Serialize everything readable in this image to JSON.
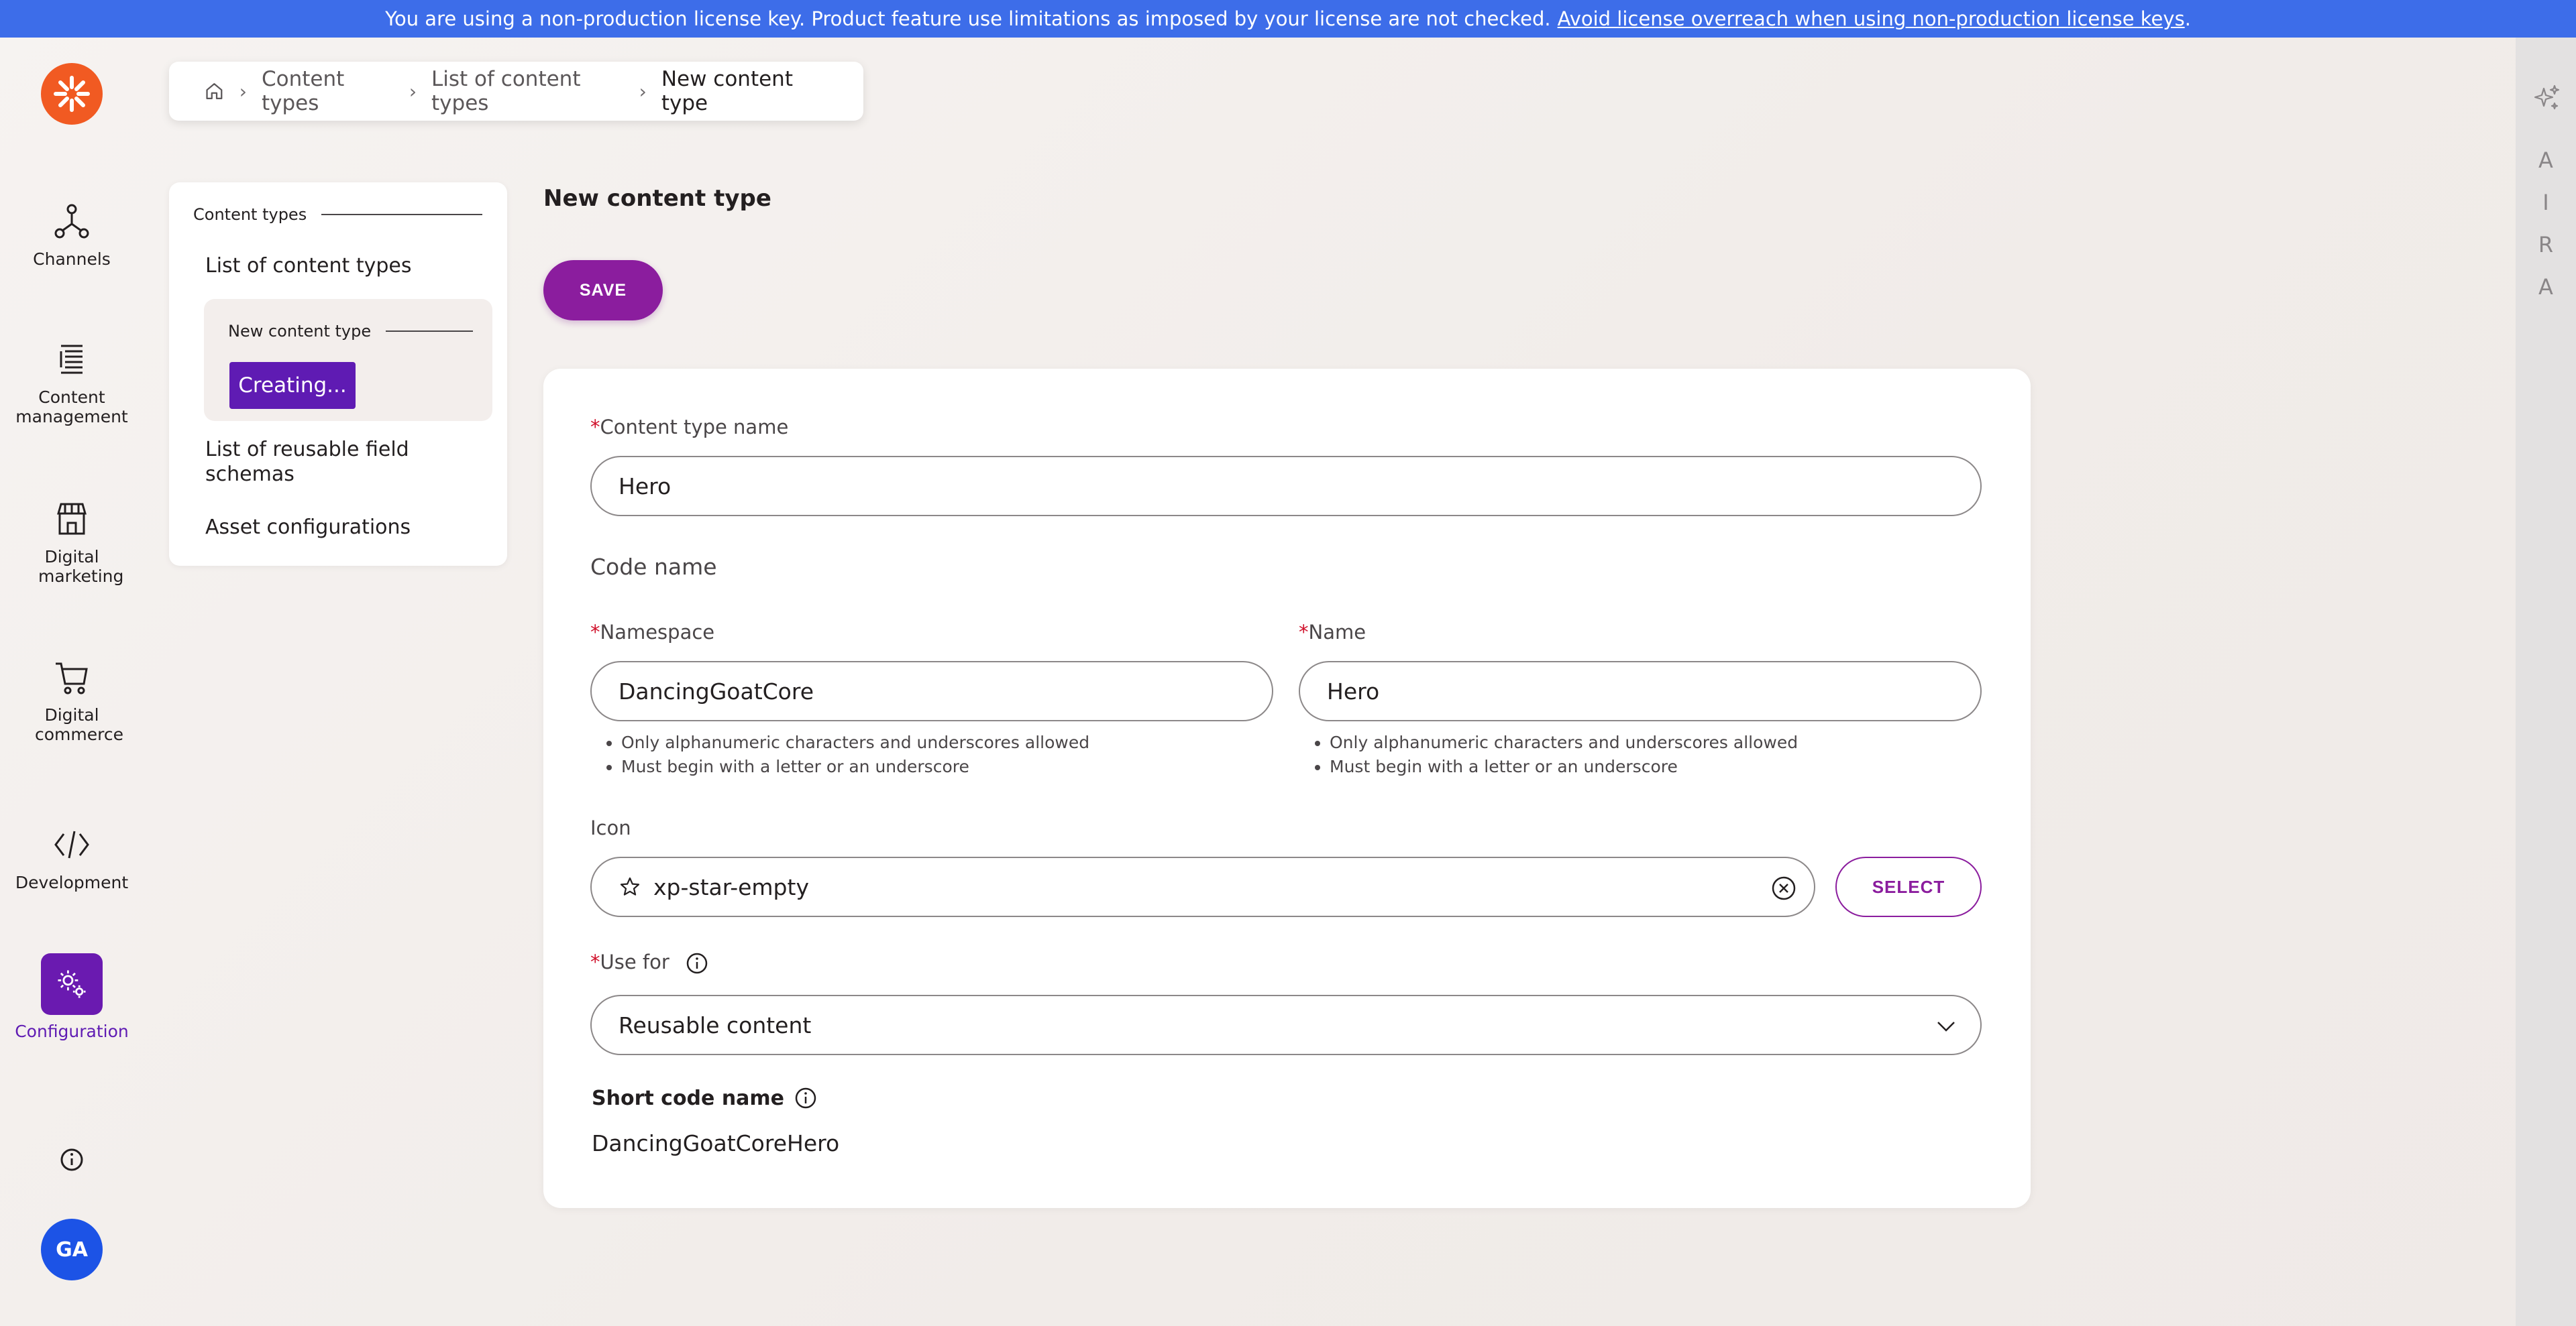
{
  "banner": {
    "message": "You are using a non-production license key. Product feature use limitations as imposed by your license are not checked.",
    "link": "Avoid license overreach when using non-production license keys",
    "suffix": "."
  },
  "nav": {
    "items": [
      {
        "label": "Channels"
      },
      {
        "label": "Content management"
      },
      {
        "label": "Digital marketing"
      },
      {
        "label": "Digital commerce"
      },
      {
        "label": "Development"
      },
      {
        "label": "Configuration"
      }
    ],
    "avatar": "GA"
  },
  "breadcrumb": {
    "items": [
      "Content types",
      "List of content types",
      "New content type"
    ]
  },
  "menu": {
    "group_label": "Content types",
    "list_content_types": "List of content types",
    "sub_label": "New content type",
    "creating": "Creating...",
    "reusable_schemas": "List of reusable field schemas",
    "asset_configurations": "Asset configurations"
  },
  "page": {
    "title": "New content type",
    "save_label": "SAVE"
  },
  "form": {
    "required_mark": "*",
    "content_type_name_label": "Content type name",
    "content_type_name_value": "Hero",
    "code_name_title": "Code name",
    "namespace_label": "Namespace",
    "namespace_value": "DancingGoatCore",
    "name_label": "Name",
    "name_value": "Hero",
    "hint_1": "Only alphanumeric characters and underscores allowed",
    "hint_2": "Must begin with a letter or an underscore",
    "icon_label": "Icon",
    "icon_value": "xp-star-empty",
    "select_label": "SELECT",
    "use_for_label": "Use for",
    "use_for_value": "Reusable content",
    "short_code_label": "Short code name",
    "short_code_value": "DancingGoatCoreHero"
  },
  "aira": {
    "letters": [
      "A",
      "I",
      "R",
      "A"
    ]
  },
  "colors": {
    "banner": "#3d6de9",
    "brand_orange": "#f15a22",
    "primary": "#8b1d9e",
    "active_purple": "#5f1bb3",
    "required": "#d0112b",
    "avatar": "#1c53e6"
  }
}
